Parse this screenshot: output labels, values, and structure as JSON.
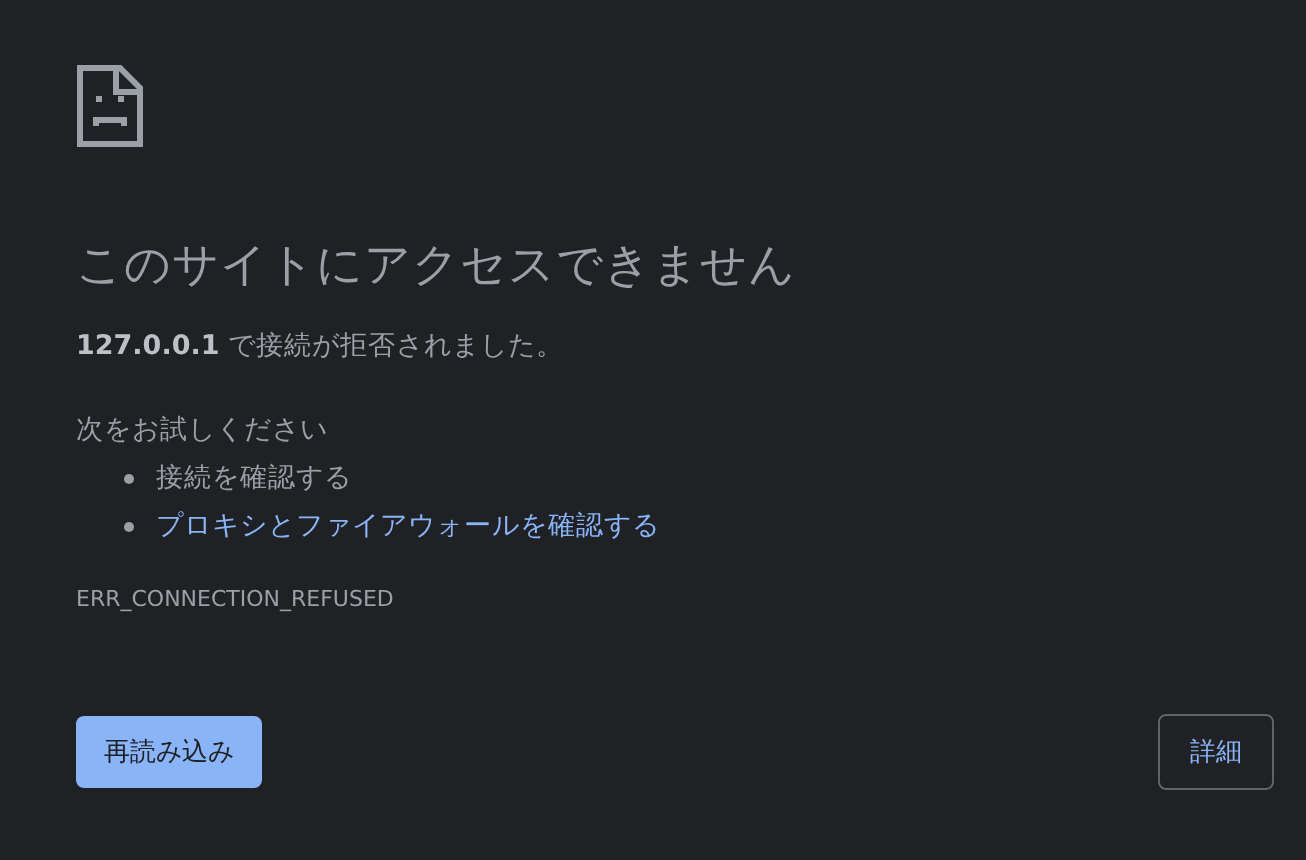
{
  "heading": "このサイトにアクセスできません",
  "summary": "**127.0.0.1** で接続が拒否されました。",
  "suggestions_title": "次をお試しください",
  "suggestions": [
    {
      "kind": "text",
      "label": "接続を確認する"
    },
    {
      "kind": "link",
      "label": "プロキシとファイアウォールを確認する"
    }
  ],
  "error_code": "ERR_CONNECTION_REFUSED",
  "buttons": {
    "reload": "再読み込み",
    "details": "詳細"
  }
}
